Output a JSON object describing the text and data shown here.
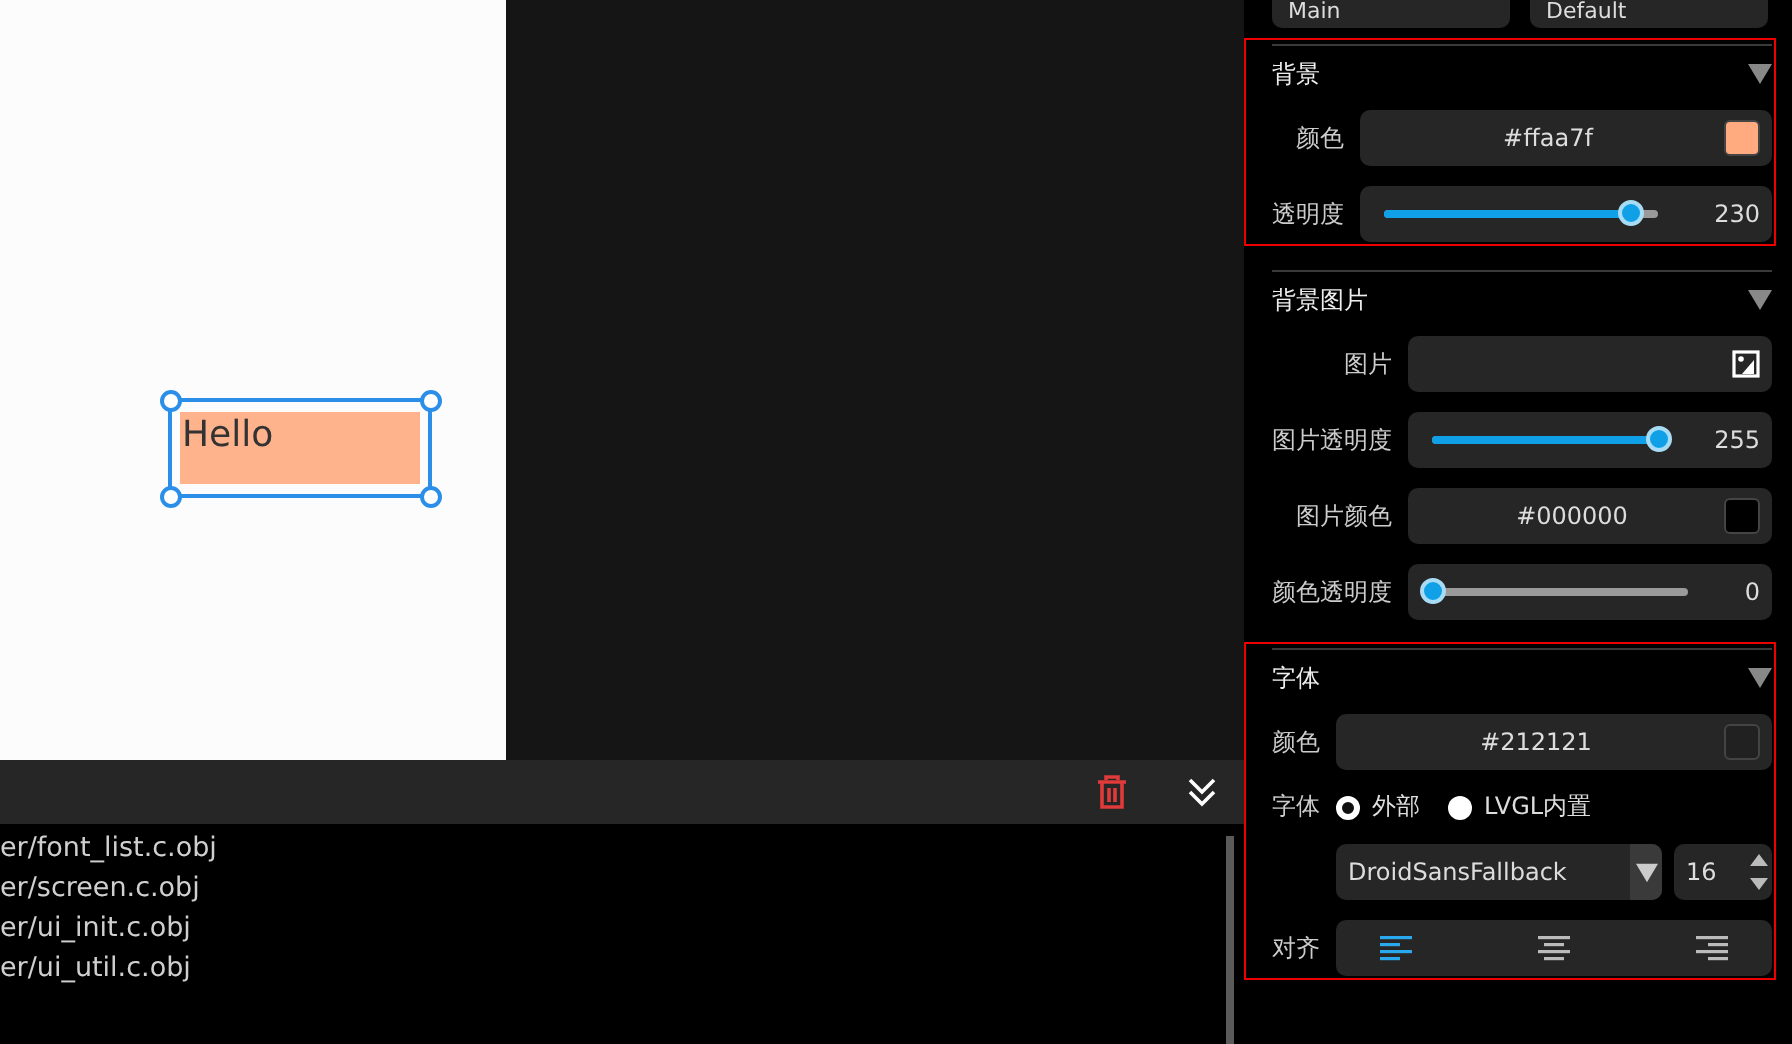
{
  "canvas": {
    "label": {
      "text": "Hello",
      "selected": true
    }
  },
  "console": {
    "lines": [
      "er/font_list.c.obj",
      "er/screen.c.obj",
      "er/ui_init.c.obj",
      "er/ui_util.c.obj"
    ]
  },
  "top_selects": [
    "Main",
    "Default"
  ],
  "sections": [
    {
      "title": "背景",
      "highlighted": true,
      "rows": [
        {
          "kind": "color",
          "label": "颜色",
          "value": "#ffaa7f",
          "color": "#ffaa7f"
        },
        {
          "kind": "slider",
          "label": "透明度",
          "level": 0.9,
          "reading": "230"
        }
      ]
    },
    {
      "title": "背景图片",
      "highlighted": false,
      "rows": [
        {
          "kind": "image",
          "label": "图片"
        },
        {
          "kind": "slider",
          "label": "图片透明度",
          "level": 1,
          "reading": "255"
        },
        {
          "kind": "color",
          "label": "图片颜色",
          "value": "#000000",
          "color": "#000000"
        },
        {
          "kind": "slider",
          "label": "颜色透明度",
          "level": 0,
          "reading": "0"
        }
      ]
    },
    {
      "title": "字体",
      "highlighted": true,
      "rows": [
        {
          "kind": "color",
          "label": "颜色",
          "value": "#212121",
          "color": "#212121"
        },
        {
          "kind": "radio",
          "label": "字体",
          "options": [
            {
              "label": "外部",
              "selected": true
            },
            {
              "label": "LVGL内置",
              "selected": false
            }
          ]
        },
        {
          "kind": "font",
          "font": "DroidSansFallback",
          "size": "16"
        },
        {
          "kind": "align",
          "label": "对齐",
          "options": [
            {
              "kind": "left",
              "selected": true
            },
            {
              "kind": "center",
              "selected": false
            },
            {
              "kind": "right",
              "selected": false
            }
          ]
        }
      ]
    }
  ]
}
